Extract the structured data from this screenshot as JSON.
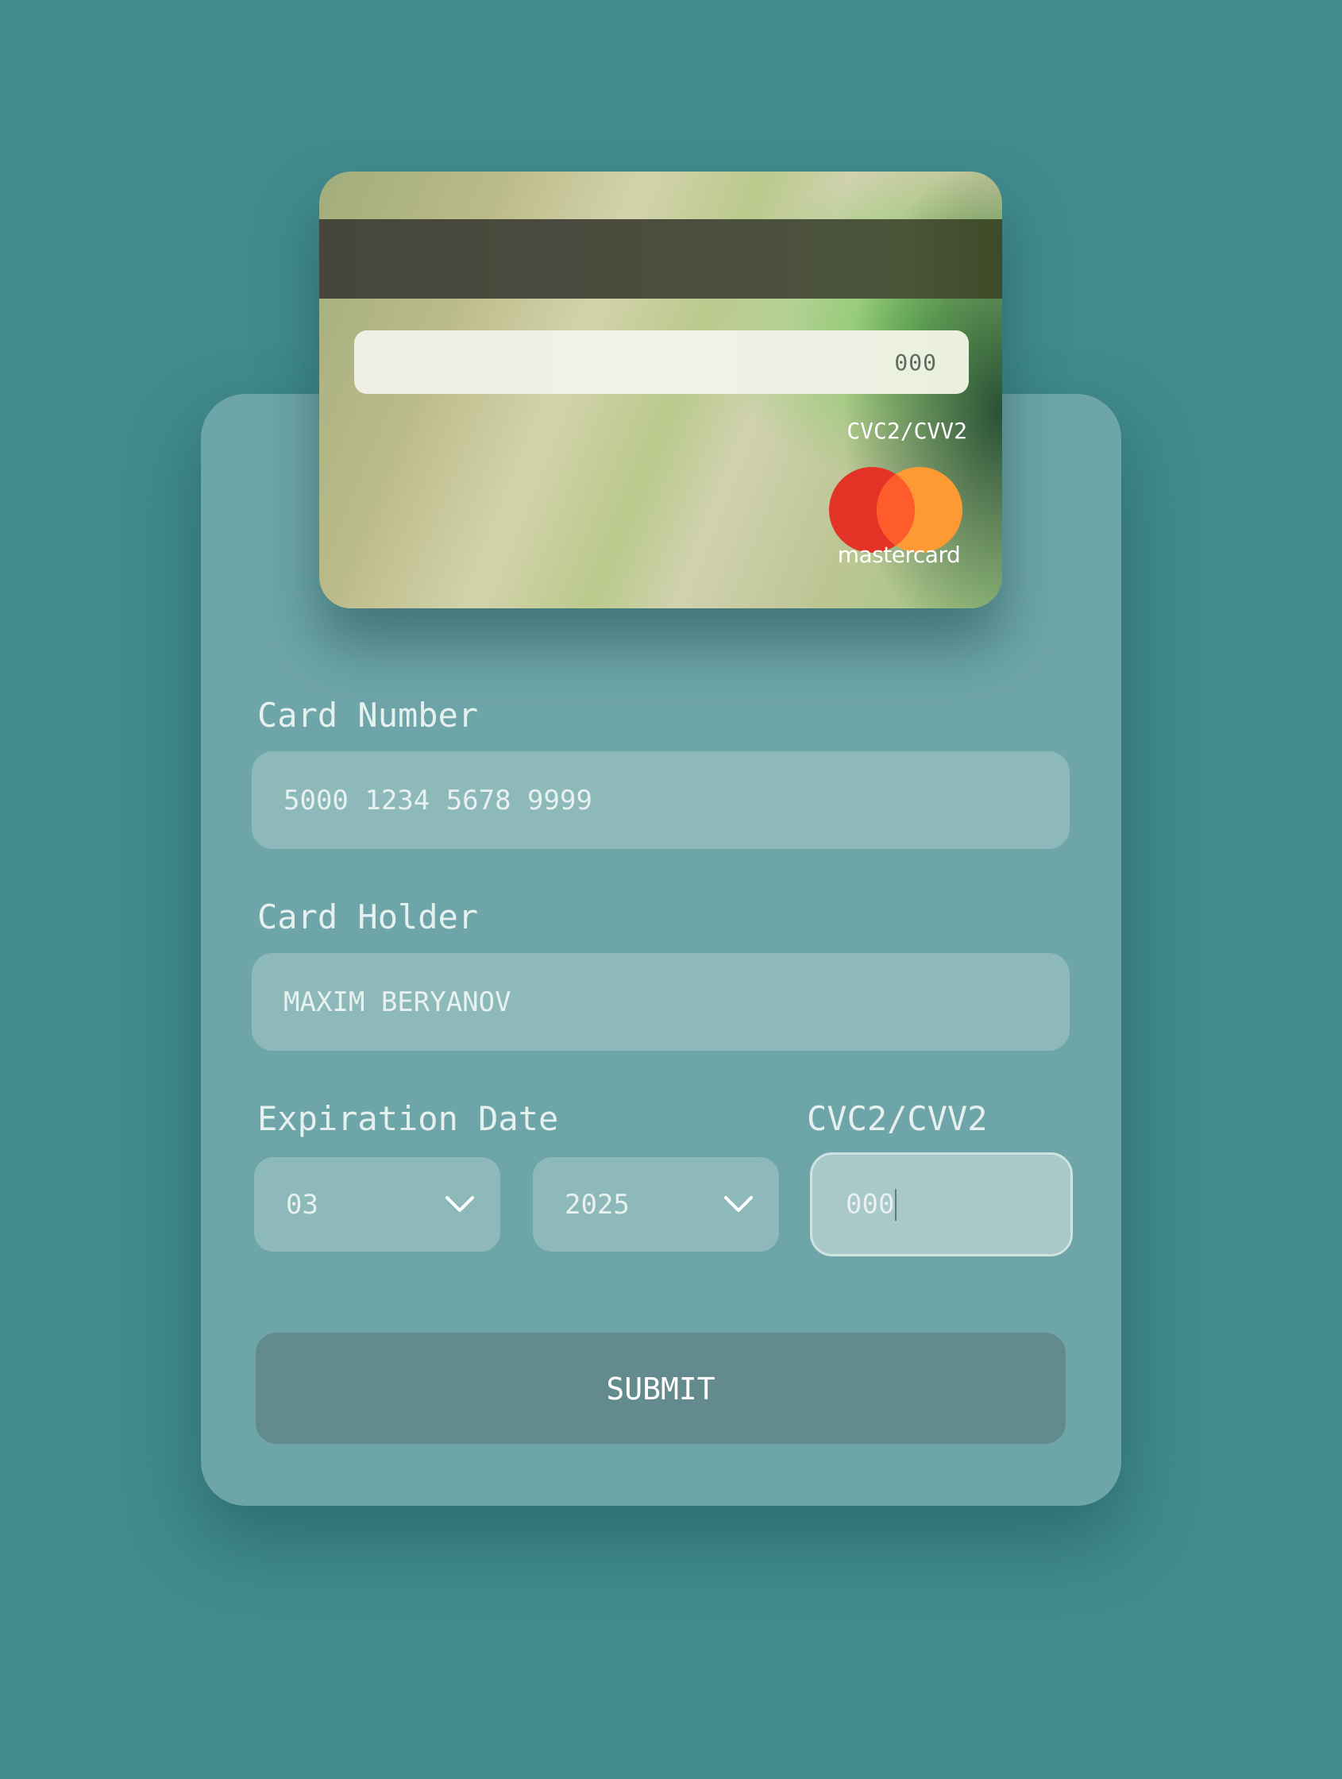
{
  "card_preview": {
    "cvc_value": "000",
    "cvc_label": "CVC2/CVV2",
    "brand": "mastercard",
    "brand_colors": {
      "red": "#e33326",
      "orange": "#fe9a34",
      "overlap": "#fe5c2a"
    }
  },
  "form": {
    "card_number": {
      "label": "Card Number",
      "value": "5000 1234 5678 9999"
    },
    "card_holder": {
      "label": "Card Holder",
      "value": "MAXIM BERYANOV"
    },
    "expiration": {
      "label": "Expiration Date",
      "month": "03",
      "year": "2025"
    },
    "cvc": {
      "label": "CVC2/CVV2",
      "value": "000"
    },
    "submit_label": "SUBMIT"
  },
  "icons": {
    "dropdown": "chevron-down-icon"
  },
  "colors": {
    "background": "#418a8d",
    "panel": "#6ea5a8",
    "input": "#8db9bb",
    "input_focused": "#a8c8c9",
    "button": "#638b8d"
  }
}
